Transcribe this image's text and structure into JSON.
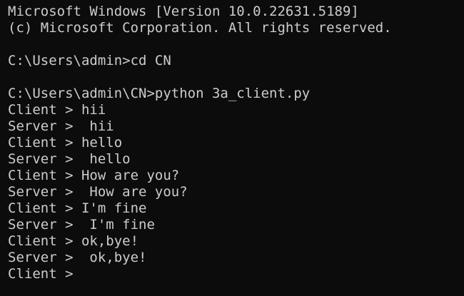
{
  "terminal": {
    "lines": [
      "Microsoft Windows [Version 10.0.22631.5189]",
      "(c) Microsoft Corporation. All rights reserved.",
      "",
      "C:\\Users\\admin>cd CN",
      "",
      "C:\\Users\\admin\\CN>python 3a_client.py",
      "Client > hii",
      "Server >  hii",
      "Client > hello",
      "Server >  hello",
      "Client > How are you?",
      "Server >  How are you?",
      "Client > I'm fine",
      "Server >  I'm fine",
      "Client > ok,bye!",
      "Server >  ok,bye!",
      "Client > "
    ]
  }
}
